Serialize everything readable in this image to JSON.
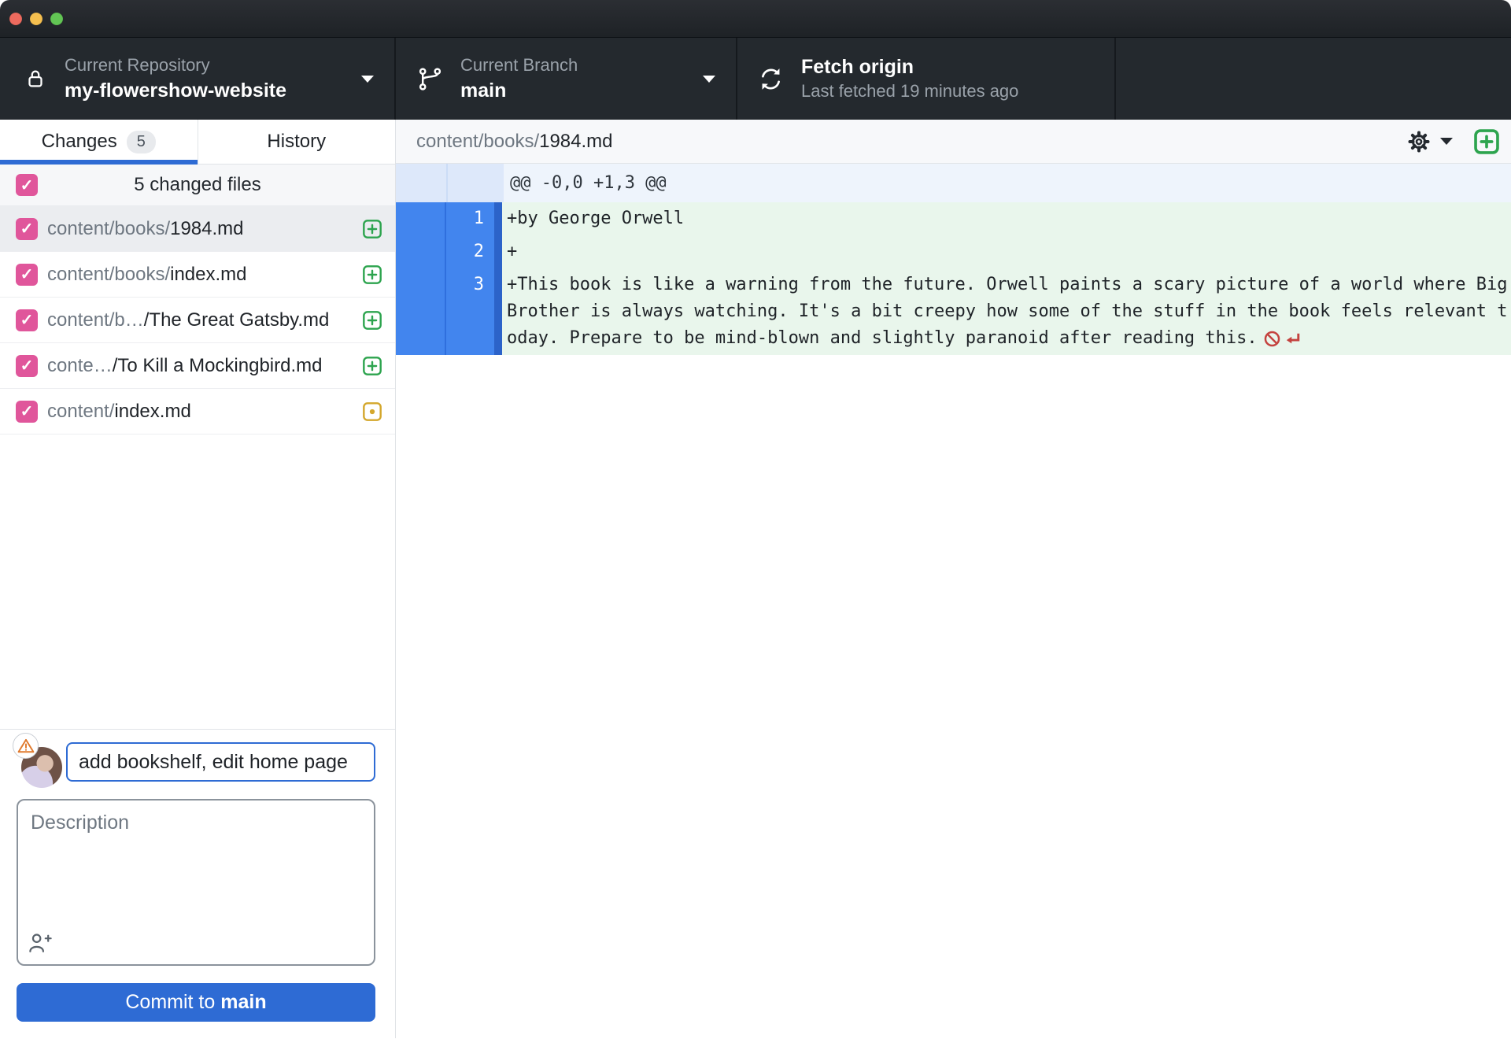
{
  "toolbar": {
    "repo": {
      "label": "Current Repository",
      "value": "my-flowershow-website"
    },
    "branch": {
      "label": "Current Branch",
      "value": "main"
    },
    "fetch": {
      "title": "Fetch origin",
      "subtitle": "Last fetched 19 minutes ago"
    }
  },
  "sidebar": {
    "tabs": {
      "changes": "Changes",
      "changes_count": "5",
      "history": "History"
    },
    "files_header": "5 changed files",
    "files": [
      {
        "prefix": "content/books/",
        "name": "1984.md",
        "status": "added",
        "selected": true
      },
      {
        "prefix": "content/books/",
        "name": "index.md",
        "status": "added",
        "selected": false
      },
      {
        "prefix": "content/b…",
        "name": "/The Great Gatsby.md",
        "status": "added",
        "selected": false
      },
      {
        "prefix": "conte…",
        "name": "/To Kill a Mockingbird.md",
        "status": "added",
        "selected": false
      },
      {
        "prefix": "content/",
        "name": "index.md",
        "status": "modified",
        "selected": false
      }
    ],
    "commit": {
      "summary_value": "add bookshelf, edit home page",
      "description_placeholder": "Description",
      "button_prefix": "Commit to",
      "button_branch": "main"
    }
  },
  "diff": {
    "file_path_prefix": "content/books/",
    "file_name": "1984.md",
    "hunk_header": "@@ -0,0 +1,3 @@",
    "lines": [
      {
        "new_number": "1",
        "text": "+by George Orwell",
        "no_newline": false
      },
      {
        "new_number": "2",
        "text": "+",
        "no_newline": false
      },
      {
        "new_number": "3",
        "text": "+This book is like a warning from the future. Orwell paints a scary picture of a world where Big Brother is always watching. It's a bit creepy how some of the stuff in the book feels relevant today. Prepare to be mind-blown and slightly paranoid after reading this.",
        "no_newline": true
      }
    ]
  },
  "icons": {
    "lock": "padlock",
    "git-branch": "branch glyph",
    "sync": "circular arrows",
    "gear": "settings cog",
    "plus-box": "added-file square plus",
    "dot-box": "modified-file square dot",
    "warning": "orange triangle exclamation",
    "person-plus": "add co-author",
    "no-entry": "circle slash",
    "return-arrow": "carriage return"
  },
  "colors": {
    "accent_blue": "#2e6bd4",
    "gutter_blue": "#4285ee",
    "gutter_strip": "#2c63c9",
    "added_line_bg": "#e9f6ec",
    "hunk_bg": "#eef4fc",
    "hunk_gutter_bg": "#dde8fa",
    "checkbox_pink": "#e0569b",
    "added_green": "#2da44e",
    "modified_yellow": "#d4a72c",
    "marker_red": "#c4433f",
    "toolbar_bg": "#24292e",
    "warning_orange": "#e07a2e"
  }
}
